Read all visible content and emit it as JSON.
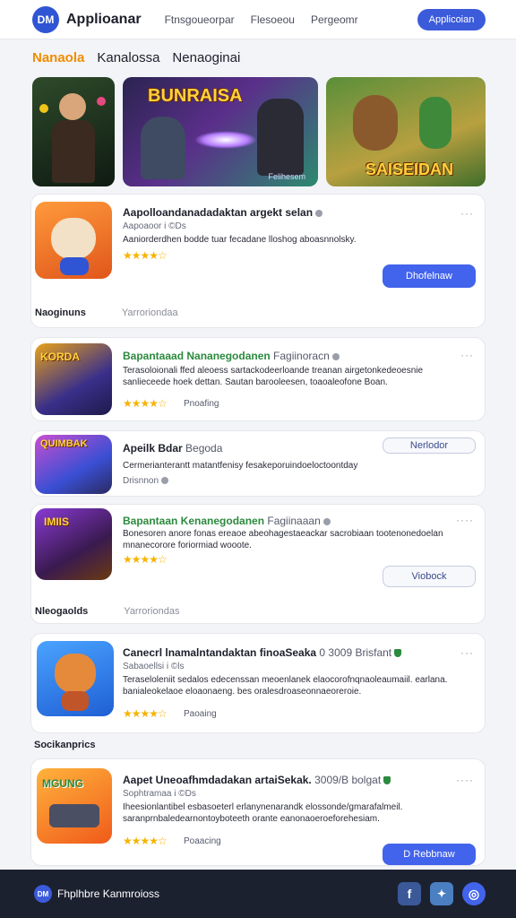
{
  "header": {
    "logo_text": "DM",
    "brand": "Applioanar",
    "nav": [
      "Ftnsgoueorpar",
      "Flesoeou",
      "Pergeomr"
    ],
    "cta_label": "Applicoian"
  },
  "tabs": [
    {
      "label": "Nanaola",
      "active": true
    },
    {
      "label": "Kanalossa",
      "active": false
    },
    {
      "label": "Nenaoginai",
      "active": false
    }
  ],
  "banners": [
    {
      "title": ""
    },
    {
      "title": "BUNRAISA",
      "sub": "Felihesem"
    },
    {
      "title": "SAISEIDAN"
    }
  ],
  "featured": {
    "title": "Aapolloandanadadaktan argekt selan",
    "sub": "Aapoaoor i ©Ds",
    "desc": "Aaniorderdhen bodde tuar fecadane lloshog aboasnnolsky.",
    "stars": "★★★★☆",
    "button": "Dhofelnaw"
  },
  "section1": {
    "title": "Naoginuns",
    "meta": "Yarroriondaa"
  },
  "card2": {
    "title_green": "Bapantaaad Nananegodanen",
    "title_dim": "Fagiinoracn",
    "more": "···",
    "desc": "Terasoloionali ffed aleoess sartackodeerloande treanan airgetonkedeoesnie sanlieceede hoek dettan. Sautan barooleesen, toaoaleofone Boan.",
    "stars": "★★★★☆",
    "rating": "Pnoafing",
    "icon_title": "KORDA"
  },
  "card3": {
    "title": "Apeilk Bdar",
    "title_dim": "Begoda",
    "desc": "Cermerianterantt matantfenisy fesakeporuindoeloctoontday",
    "sub": "Drisnnon",
    "button": "Nerlodor",
    "icon_title": "QUIMBAK"
  },
  "card4": {
    "title_green": "Bapantaan Kenanegodanen",
    "title_dim": "Fagiinaaan",
    "more": "····",
    "desc": "Bonesoren anore fonas ereaoe abeohagestaeackar sacrobiaan tootenonedoelan mnanecorore foriormiad wooote.",
    "stars": "★★★★☆",
    "button": "Viobock",
    "icon_title": "IMIIS"
  },
  "section2": {
    "title": "Nleogaolds",
    "meta": "Yarroriondas"
  },
  "card5": {
    "title": "Canecrl lnamalntandaktan finoaSeaka",
    "title_dim": "0 3009 Brisfant",
    "sub": "Sabaoellsi i ©ls",
    "more": "···",
    "desc": "Teraseloleniit sedalos edecenssan meoenlanek elaocorofnqnaoleaumaiil. earlana. banialeokelaoe eloaonaeng. bes oralesdroaseonnaeoreroie.",
    "stars": "★★★★☆",
    "rating": "Paoaing"
  },
  "section3": {
    "title": "Socikanprics"
  },
  "card6": {
    "title": "Aapet Uneoafhmdadakan artaiSekak.",
    "title_dim": "3009/B bolgat",
    "sub": "Sophtramaa i ©Ds",
    "more": "····",
    "desc": "Iheesionlantibel esbasoeterl erlanynenarandk elossonde/gmarafalmeil. saranprnbaledearnontoyboteeth orante eanonaoeroeforehesiam.",
    "stars": "★★★★☆",
    "rating": "Poaacing",
    "button": "D Rebbnaw",
    "icon_title": "MGUNG"
  },
  "footer": {
    "logo_text": "DM",
    "brand": "Fhplhbre Kanmroioss",
    "social": [
      {
        "name": "facebook-icon",
        "glyph": "f",
        "color": "#3b5998"
      },
      {
        "name": "twitter-icon",
        "glyph": "🐦",
        "color": "#4a7fc1"
      },
      {
        "name": "globe-icon",
        "glyph": "◎",
        "color": "#4263eb"
      }
    ]
  }
}
